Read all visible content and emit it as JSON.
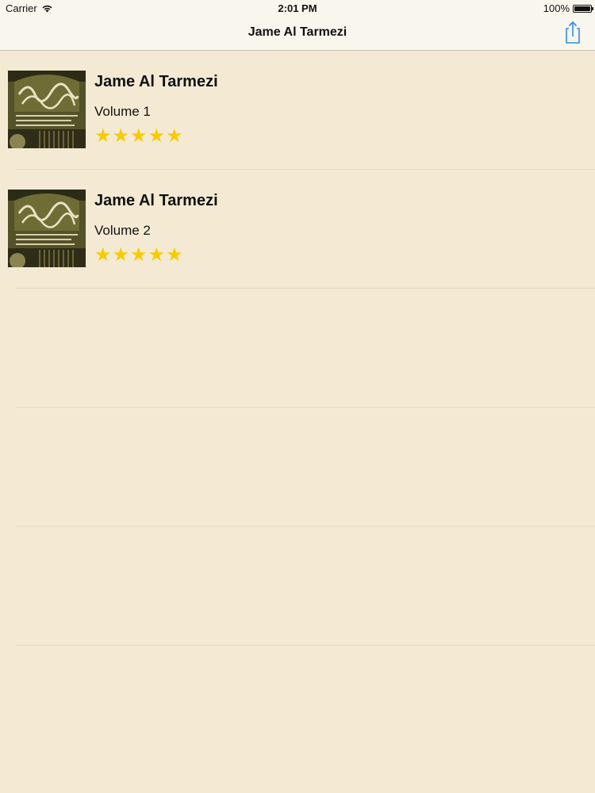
{
  "status": {
    "carrier": "Carrier",
    "time": "2:01 PM",
    "battery": "100%"
  },
  "nav": {
    "title": "Jame Al Tarmezi",
    "share_icon": "share-icon"
  },
  "books": [
    {
      "title": "Jame Al Tarmezi",
      "volume": "Volume 1",
      "rating": 5
    },
    {
      "title": "Jame Al Tarmezi",
      "volume": "Volume 2",
      "rating": 5
    }
  ],
  "colors": {
    "background": "#f4ead3",
    "star": "#f7cb00",
    "accent": "#2f8be8"
  }
}
